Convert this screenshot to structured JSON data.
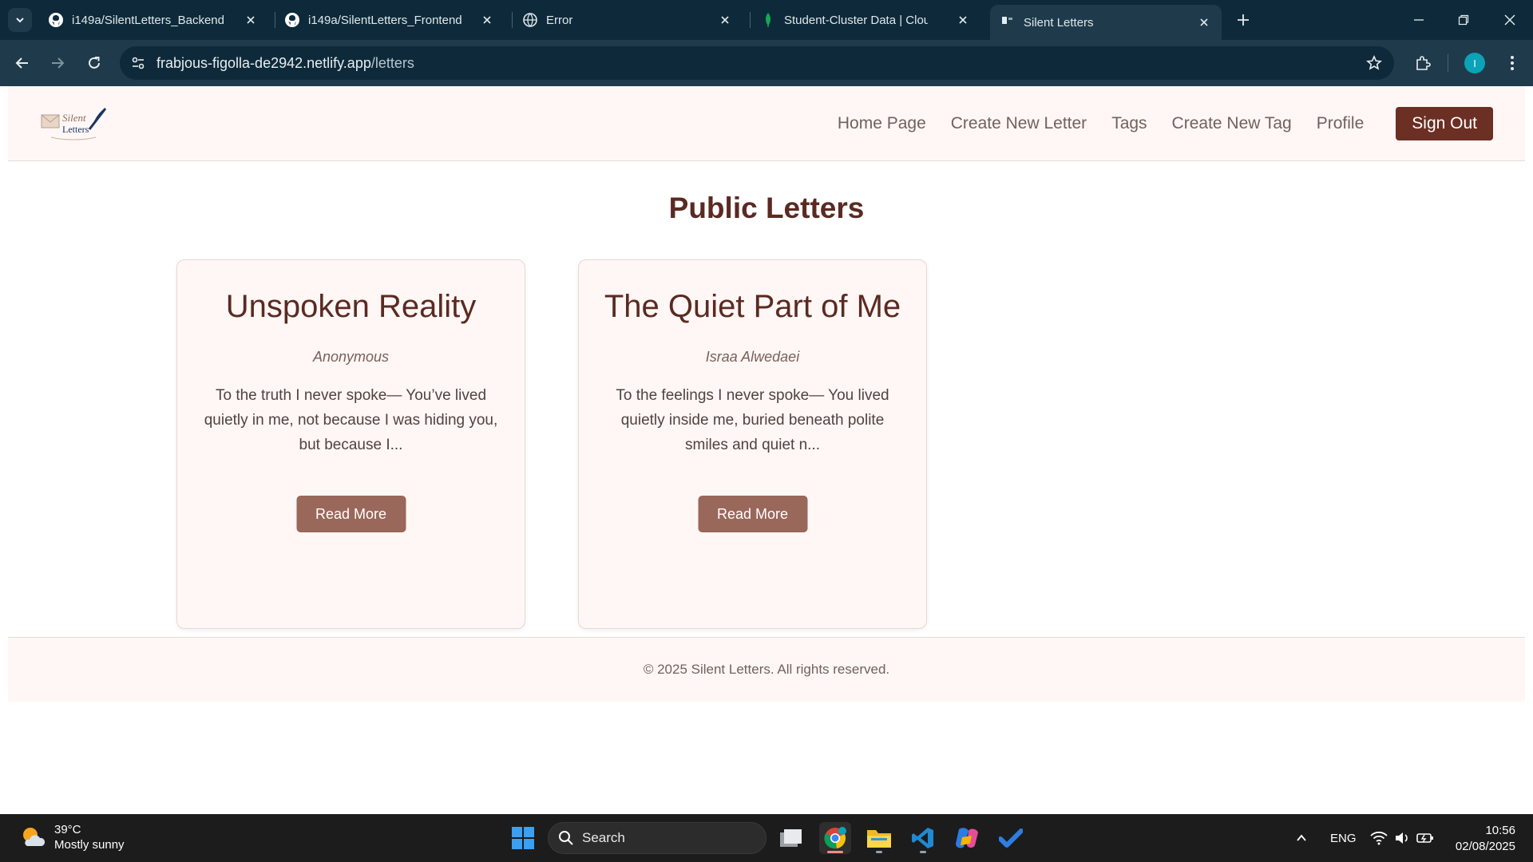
{
  "browser": {
    "tabs": [
      {
        "title": "i149a/SilentLetters_Backend",
        "icon": "github-icon"
      },
      {
        "title": "i149a/SilentLetters_Frontend",
        "icon": "github-icon"
      },
      {
        "title": "Error",
        "icon": "globe-icon"
      },
      {
        "title": "Student-Cluster Data | Cloud: M",
        "icon": "mongodb-leaf-icon"
      },
      {
        "title": "Silent Letters",
        "icon": "page-favicon",
        "active": true
      }
    ],
    "url_host": "frabjous-figolla-de2942.netlify.app",
    "url_path": "/letters",
    "profile_initial": "I"
  },
  "site": {
    "logo_line1": "Silent",
    "logo_line2": "Letters",
    "nav": [
      "Home Page",
      "Create New Letter",
      "Tags",
      "Create New Tag",
      "Profile"
    ],
    "sign_out": "Sign Out"
  },
  "page": {
    "title": "Public Letters",
    "letters": [
      {
        "title": "Unspoken Reality",
        "author": "Anonymous",
        "excerpt": "To the truth I never spoke— You’ve lived quietly in me, not because I was hiding you, but because I...",
        "button": "Read More"
      },
      {
        "title": "The Quiet Part of Me",
        "author": "Israa Alwedaei",
        "excerpt": "To the feelings I never spoke— You lived quietly inside me, buried beneath polite smiles and quiet n...",
        "button": "Read More"
      }
    ],
    "footer": "© 2025 Silent Letters. All rights reserved."
  },
  "taskbar": {
    "weather_temp": "39°C",
    "weather_desc": "Mostly sunny",
    "search_label": "Search",
    "language": "ENG",
    "time": "10:56",
    "date": "02/08/2025"
  },
  "colors": {
    "brand_dark": "#6b2f24",
    "button": "#9a675b",
    "header_bg": "#fff7f5"
  }
}
